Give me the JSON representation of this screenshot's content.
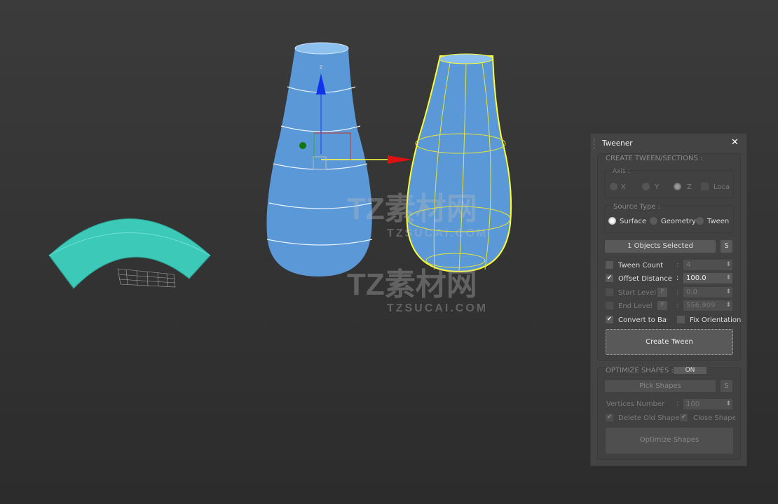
{
  "viewport": {
    "gizmo_axis_z": "z",
    "watermark": [
      "TZ素材网",
      "TZSUCAI.COM"
    ],
    "colors": {
      "vase": "#5a98d8",
      "arc": "#3cc9b8",
      "selection": "#ffff33"
    }
  },
  "panel": {
    "title": "Tweener",
    "close": "✕",
    "section_create": "CREATE TWEEN/SECTIONS :",
    "axis": {
      "label": "Axis :",
      "options": [
        "X",
        "Y",
        "Z",
        "Loca"
      ],
      "selected": "Z",
      "local_checked": false
    },
    "source_type": {
      "label": "Source Type :",
      "options": [
        "Surface",
        "Geometry",
        "Tween"
      ],
      "selected": "Surface"
    },
    "objects_selected": "1 Objects Selected",
    "s_button": "S",
    "p_button": "P",
    "tween_count": {
      "label": "Tween Count",
      "checked": false,
      "value": "4"
    },
    "offset_distance": {
      "label": "Offset Distance",
      "checked": true,
      "value": "100.0"
    },
    "start_level": {
      "label": "Start Level",
      "checked": false,
      "value": "0.0"
    },
    "end_level": {
      "label": "End Level",
      "checked": false,
      "value": "556.909"
    },
    "convert_to_base": {
      "label": "Convert to Base",
      "checked": true
    },
    "fix_orientation": {
      "label": "Fix Orientation",
      "checked": false
    },
    "create_tween": "Create Tween",
    "section_optimize": "OPTIMIZE SHAPES :",
    "optimize_toggle": "ON",
    "pick_shapes": "Pick Shapes",
    "vertices_number": {
      "label": "Vertices Number",
      "value": "100"
    },
    "delete_old_shapes": {
      "label": "Delete Old Shapes",
      "checked": true
    },
    "close_shapes": {
      "label": "Close Shapes",
      "checked": true
    },
    "optimize_shapes": "Optimize Shapes",
    "colon": ":"
  }
}
